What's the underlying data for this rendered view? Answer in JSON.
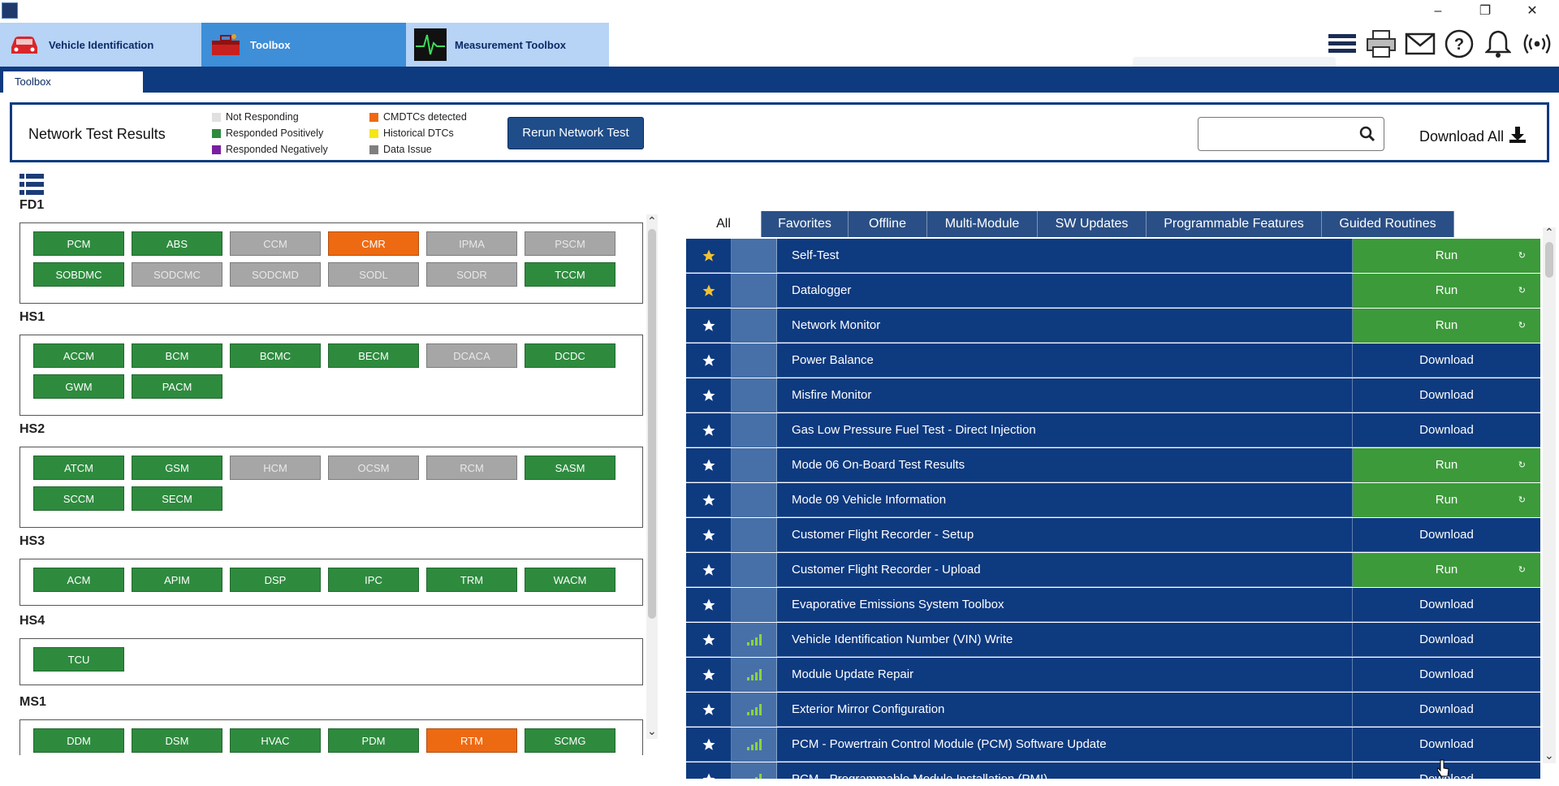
{
  "app_tabs": [
    {
      "label": "Vehicle Identification",
      "icon": "car-icon"
    },
    {
      "label": "Toolbox",
      "icon": "toolbox-icon"
    },
    {
      "label": "Measurement Toolbox",
      "icon": "oscilloscope-icon"
    }
  ],
  "subtab": "Toolbox",
  "network_test": {
    "title": "Network Test Results",
    "legend": [
      {
        "label": "Not Responding",
        "color": "#e0e0e0"
      },
      {
        "label": "Responded Positively",
        "color": "#2e8b3e"
      },
      {
        "label": "Responded Negatively",
        "color": "#7a1fa2"
      },
      {
        "label": "CMDTCs detected",
        "color": "#ee6a12"
      },
      {
        "label": "Historical DTCs",
        "color": "#f5e616"
      },
      {
        "label": "Data Issue",
        "color": "#7f7f7f"
      }
    ],
    "rerun_label": "Rerun Network Test",
    "search_placeholder": "",
    "download_all_label": "Download All"
  },
  "groups": [
    {
      "name": "FD1",
      "modules": [
        {
          "label": "PCM",
          "status": "green"
        },
        {
          "label": "ABS",
          "status": "green"
        },
        {
          "label": "CCM",
          "status": "gray"
        },
        {
          "label": "CMR",
          "status": "orange"
        },
        {
          "label": "IPMA",
          "status": "gray"
        },
        {
          "label": "PSCM",
          "status": "gray"
        },
        {
          "label": "SOBDMC",
          "status": "green"
        },
        {
          "label": "SODCMC",
          "status": "gray"
        },
        {
          "label": "SODCMD",
          "status": "gray"
        },
        {
          "label": "SODL",
          "status": "gray"
        },
        {
          "label": "SODR",
          "status": "gray"
        },
        {
          "label": "TCCM",
          "status": "green"
        }
      ]
    },
    {
      "name": "HS1",
      "modules": [
        {
          "label": "ACCM",
          "status": "green"
        },
        {
          "label": "BCM",
          "status": "green"
        },
        {
          "label": "BCMC",
          "status": "green"
        },
        {
          "label": "BECM",
          "status": "green"
        },
        {
          "label": "DCACA",
          "status": "gray"
        },
        {
          "label": "DCDC",
          "status": "green"
        },
        {
          "label": "GWM",
          "status": "green"
        },
        {
          "label": "PACM",
          "status": "green"
        }
      ]
    },
    {
      "name": "HS2",
      "modules": [
        {
          "label": "ATCM",
          "status": "green"
        },
        {
          "label": "GSM",
          "status": "green"
        },
        {
          "label": "HCM",
          "status": "gray"
        },
        {
          "label": "OCSM",
          "status": "gray"
        },
        {
          "label": "RCM",
          "status": "gray"
        },
        {
          "label": "SASM",
          "status": "green"
        },
        {
          "label": "SCCM",
          "status": "green"
        },
        {
          "label": "SECM",
          "status": "green"
        }
      ]
    },
    {
      "name": "HS3",
      "modules": [
        {
          "label": "ACM",
          "status": "green"
        },
        {
          "label": "APIM",
          "status": "green"
        },
        {
          "label": "DSP",
          "status": "green"
        },
        {
          "label": "IPC",
          "status": "green"
        },
        {
          "label": "TRM",
          "status": "green"
        },
        {
          "label": "WACM",
          "status": "green"
        }
      ]
    },
    {
      "name": "HS4",
      "modules": [
        {
          "label": "TCU",
          "status": "green"
        }
      ]
    },
    {
      "name": "MS1",
      "modules": [
        {
          "label": "DDM",
          "status": "green"
        },
        {
          "label": "DSM",
          "status": "green"
        },
        {
          "label": "HVAC",
          "status": "green"
        },
        {
          "label": "PDM",
          "status": "green"
        },
        {
          "label": "RTM",
          "status": "orange"
        },
        {
          "label": "SCMG",
          "status": "green"
        }
      ]
    }
  ],
  "filter_tabs": [
    "All",
    "Favorites",
    "Offline",
    "Multi-Module",
    "SW Updates",
    "Programmable Features",
    "Guided Routines"
  ],
  "toolbox_rows": [
    {
      "name": "Self-Test",
      "action": "Run",
      "fav": true,
      "signal": false
    },
    {
      "name": "Datalogger",
      "action": "Run",
      "fav": true,
      "signal": false
    },
    {
      "name": "Network Monitor",
      "action": "Run",
      "fav": false,
      "signal": false
    },
    {
      "name": "Power Balance",
      "action": "Download",
      "fav": false,
      "signal": false
    },
    {
      "name": "Misfire Monitor",
      "action": "Download",
      "fav": false,
      "signal": false
    },
    {
      "name": "Gas Low Pressure Fuel Test - Direct Injection",
      "action": "Download",
      "fav": false,
      "signal": false
    },
    {
      "name": "Mode 06 On-Board Test Results",
      "action": "Run",
      "fav": false,
      "signal": false
    },
    {
      "name": "Mode 09 Vehicle Information",
      "action": "Run",
      "fav": false,
      "signal": false
    },
    {
      "name": "Customer Flight Recorder - Setup",
      "action": "Download",
      "fav": false,
      "signal": false
    },
    {
      "name": "Customer Flight Recorder - Upload",
      "action": "Run",
      "fav": false,
      "signal": false
    },
    {
      "name": "Evaporative Emissions System Toolbox",
      "action": "Download",
      "fav": false,
      "signal": false
    },
    {
      "name": "Vehicle Identification Number (VIN) Write",
      "action": "Download",
      "fav": false,
      "signal": true
    },
    {
      "name": "Module Update Repair",
      "action": "Download",
      "fav": false,
      "signal": true
    },
    {
      "name": "Exterior Mirror Configuration",
      "action": "Download",
      "fav": false,
      "signal": true
    },
    {
      "name": "PCM - Powertrain Control Module (PCM) Software Update",
      "action": "Download",
      "fav": false,
      "signal": true
    },
    {
      "name": "PCM - Programmable Module Installation (PMI)",
      "action": "Download",
      "fav": false,
      "signal": true
    }
  ],
  "colors": {
    "navy": "#0e3a80",
    "run_green": "#3c9a3a",
    "star_yellow": "#f2c232"
  }
}
